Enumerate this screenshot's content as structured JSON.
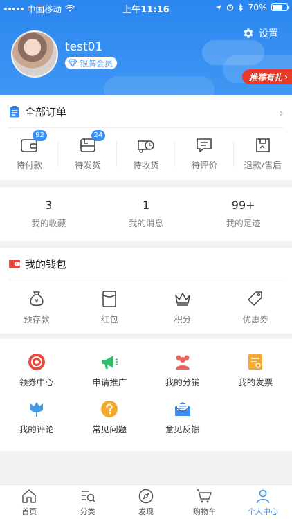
{
  "status_bar": {
    "carrier": "中国移动",
    "time": "上午11:16",
    "battery": "70%"
  },
  "header": {
    "settings_label": "设置",
    "username": "test01",
    "member_level": "银牌会员",
    "recommend_label": "推荐有礼"
  },
  "orders": {
    "title": "全部订单",
    "items": [
      {
        "label": "待付款",
        "badge": "92",
        "icon": "wallet-icon"
      },
      {
        "label": "待发货",
        "badge": "24",
        "icon": "box-icon"
      },
      {
        "label": "待收货",
        "badge": "",
        "icon": "truck-icon"
      },
      {
        "label": "待评价",
        "badge": "",
        "icon": "comment-icon"
      },
      {
        "label": "退款/售后",
        "badge": "",
        "icon": "refund-icon"
      }
    ]
  },
  "stats": [
    {
      "value": "3",
      "label": "我的收藏"
    },
    {
      "value": "1",
      "label": "我的消息"
    },
    {
      "value": "99+",
      "label": "我的足迹"
    }
  ],
  "wallet": {
    "title": "我的钱包",
    "items": [
      {
        "label": "预存款",
        "icon": "money-bag-icon"
      },
      {
        "label": "红包",
        "icon": "red-packet-icon"
      },
      {
        "label": "积分",
        "icon": "crown-icon"
      },
      {
        "label": "优惠券",
        "icon": "coupon-tag-icon"
      }
    ]
  },
  "services": {
    "row1": [
      {
        "label": "领券中心",
        "icon": "coupon-center-icon",
        "color": "#e8473d"
      },
      {
        "label": "申请推广",
        "icon": "megaphone-icon",
        "color": "#2dbf6c"
      },
      {
        "label": "我的分销",
        "icon": "group-icon",
        "color": "#f0625c"
      },
      {
        "label": "我的发票",
        "icon": "invoice-icon",
        "color": "#f3a92f"
      }
    ],
    "row2": [
      {
        "label": "我的评论",
        "icon": "tulip-icon",
        "color": "#3f9ae8"
      },
      {
        "label": "常见问题",
        "icon": "question-icon",
        "color": "#f3a92f"
      },
      {
        "label": "意见反馈",
        "icon": "envelope-icon",
        "color": "#3b8ff0"
      }
    ]
  },
  "tabbar": {
    "items": [
      {
        "label": "首页",
        "icon": "home-icon"
      },
      {
        "label": "分类",
        "icon": "category-icon"
      },
      {
        "label": "发现",
        "icon": "compass-icon"
      },
      {
        "label": "购物车",
        "icon": "cart-icon"
      },
      {
        "label": "个人中心",
        "icon": "person-icon",
        "active": true
      }
    ]
  }
}
